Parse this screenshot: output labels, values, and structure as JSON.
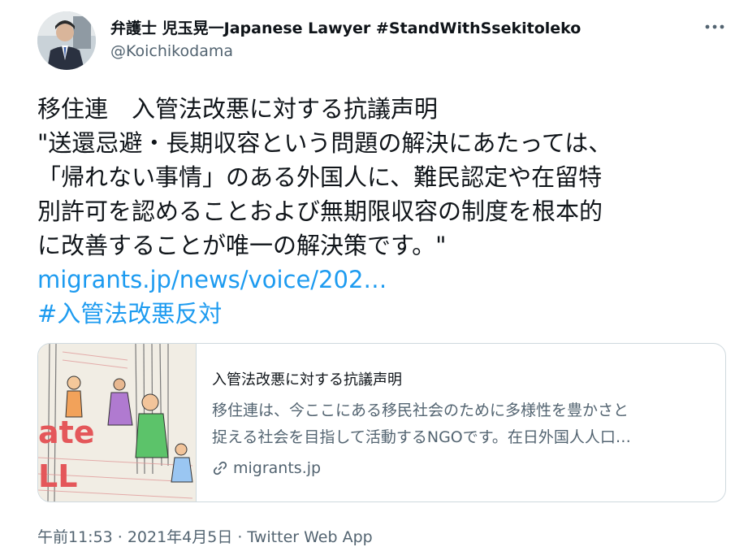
{
  "author": {
    "display_name_jp": "弁護士 児玉晃一",
    "display_name_en": "Japanese Lawyer #StandWithSsekitoleko",
    "handle": "@Koichikodama"
  },
  "more_icon": "more-horizontal-icon",
  "tweet": {
    "lines": [
      "移住連　入管法改悪に対する抗議声明",
      "\"送還忌避・長期収容という問題の解決にあたっては、",
      "「帰れない事情」のある外国人に、難民認定や在留特",
      "別許可を認めることおよび無期限収容の制度を根本的",
      "に改善することが唯一の解決策です。\""
    ],
    "link": "migrants.jp/news/voice/202…",
    "hashtag": "#入管法改悪反対"
  },
  "card": {
    "title": "入管法改悪に対する抗議声明",
    "description": [
      "移住連は、今ここにある移民社会のために多様性を豊かさと",
      "捉える社会を目指して活動するNGOです。在日外国人人口…"
    ],
    "domain": "migrants.jp",
    "image_text": [
      "ate",
      "LL"
    ],
    "link_icon": "link-icon"
  },
  "meta": {
    "time": "午前11:53",
    "date": "2021年4月5日",
    "separator": "·",
    "app": "Twitter Web App"
  },
  "colors": {
    "link": "#1d9bf0",
    "secondary_text": "#536471",
    "primary_text": "#0f1419",
    "border": "#cfd9de"
  }
}
